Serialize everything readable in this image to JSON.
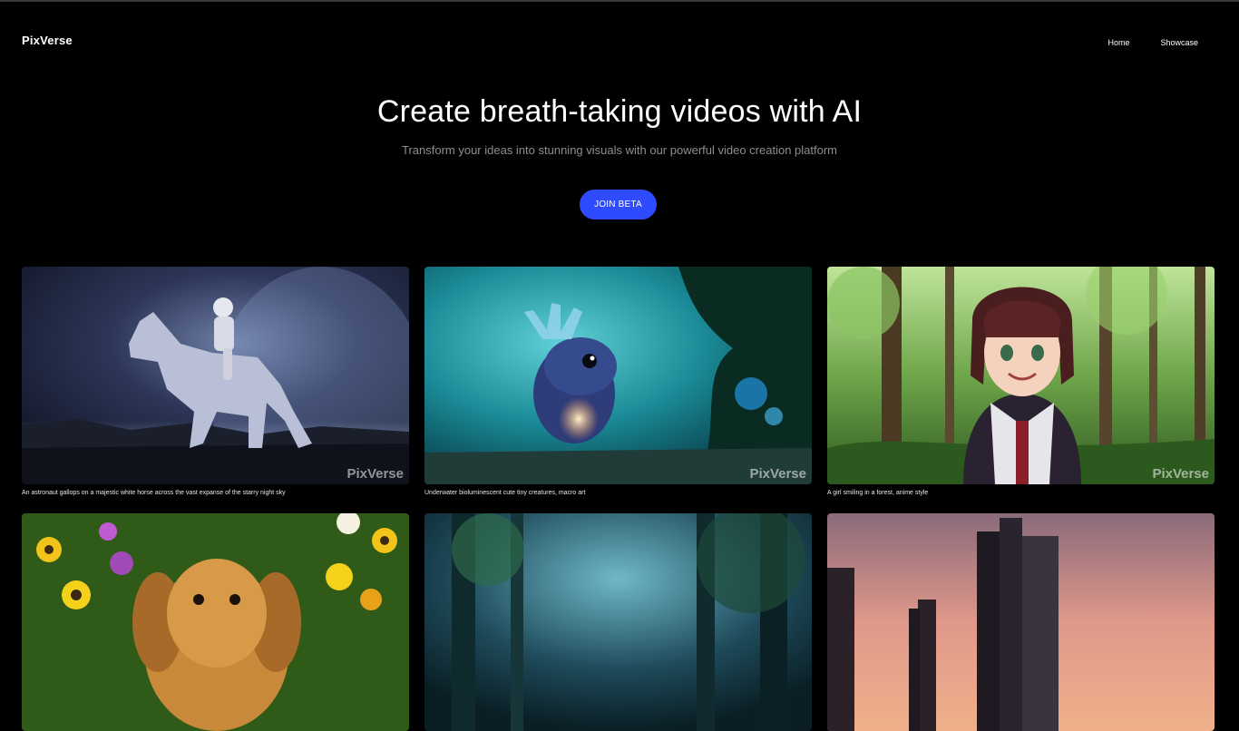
{
  "header": {
    "logo": "PixVerse",
    "nav": [
      {
        "label": "Home"
      },
      {
        "label": "Showcase"
      }
    ]
  },
  "hero": {
    "title": "Create breath-taking videos with AI",
    "subtitle": "Transform your ideas into stunning visuals with our powerful video creation platform",
    "cta_label": "JOIN BETA"
  },
  "colors": {
    "background": "#000000",
    "accent": "#2f4bff",
    "subtitle": "#8e8e8e"
  },
  "gallery": [
    {
      "caption": "An astronaut gallops on a majestic white horse across the vast expanse of the starry night sky",
      "watermark": "PixVerse"
    },
    {
      "caption": "Underwater bioluminescent cute tiny creatures, macro art",
      "watermark": "PixVerse"
    },
    {
      "caption": "A girl smiling in a forest, anime style",
      "watermark": "PixVerse"
    },
    {
      "caption": "",
      "watermark": ""
    },
    {
      "caption": "",
      "watermark": ""
    },
    {
      "caption": "",
      "watermark": ""
    }
  ]
}
